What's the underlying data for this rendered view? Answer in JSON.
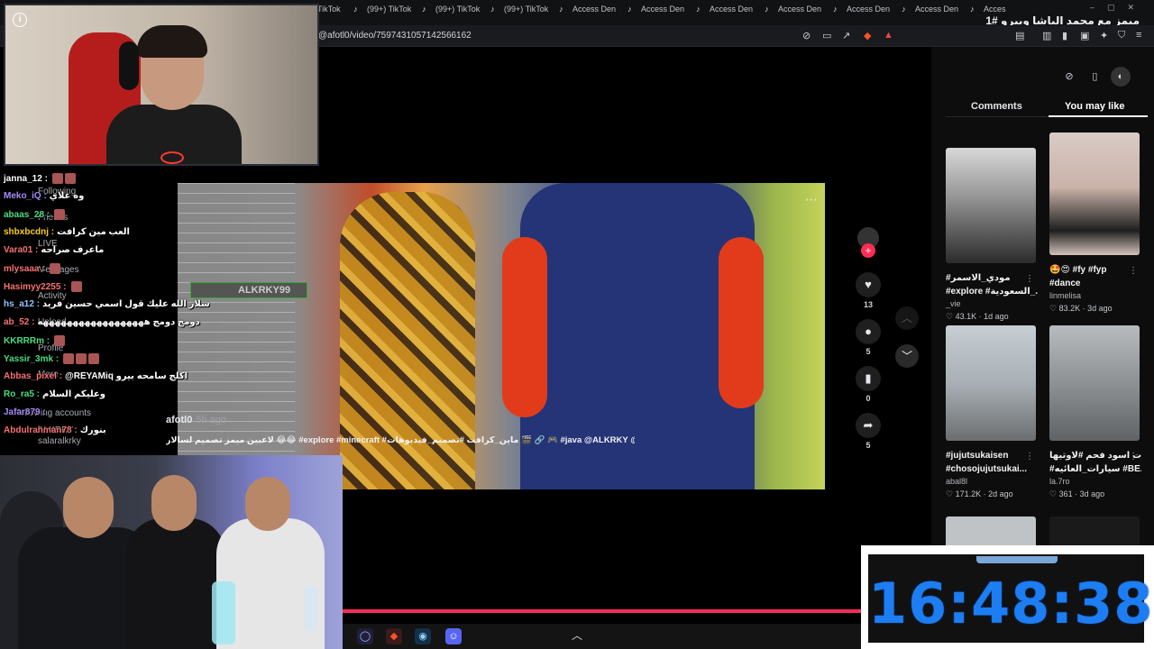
{
  "browser": {
    "tabs": [
      {
        "label": "TikTok",
        "icon": "tiktok-icon"
      },
      {
        "label": "(99+) TikTok",
        "icon": "tiktok-icon"
      },
      {
        "label": "(99+) TikTok",
        "icon": "tiktok-icon"
      },
      {
        "label": "(99+) TikTok",
        "icon": "tiktok-icon"
      },
      {
        "label": "Access Den",
        "icon": "tiktok-icon"
      },
      {
        "label": "Access Den",
        "icon": "tiktok-icon"
      },
      {
        "label": "Access Den",
        "icon": "tiktok-icon"
      },
      {
        "label": "Access Den",
        "icon": "tiktok-icon"
      },
      {
        "label": "Access Den",
        "icon": "tiktok-icon"
      },
      {
        "label": "Access Den",
        "icon": "tiktok-icon"
      },
      {
        "label": "Access Den",
        "icon": "tiktok-icon"
      }
    ],
    "url": "@afotl0/video/7597431057142566162"
  },
  "stream_title": "ميمز مع محمد الباشا وبيرو #1",
  "right_panel": {
    "tabs": {
      "comments": "Comments",
      "you_may_like": "You may like"
    },
    "cards": [
      {
        "caption1": "#مودي_الاسمر",
        "caption2": "#explore #السعودية_...",
        "user": "_vie",
        "likes": "43.1K",
        "ago": "1d ago"
      },
      {
        "caption1": "🤩😍 #fy #fyp",
        "caption2": "#dance",
        "user": "linmelisa",
        "likes": "83.2K",
        "ago": "3d ago"
      },
      {
        "caption1": "#jujutsukaisen",
        "caption2": "#chosojujutsukai...",
        "user": "abal8l",
        "likes": "171.2K",
        "ago": "2d ago"
      },
      {
        "caption1": "اطارات اسود فحم #لاوتيها",
        "caption2": "#سيارات_العائيه #BE...",
        "user": "la.7ro",
        "likes": "361",
        "ago": "3d ago"
      }
    ]
  },
  "video": {
    "author": "afotl0",
    "posted": "5h ago",
    "description": "لاعبين ميمز تصميم لسالار 😂😂 #explore #minecraft #ماين_كرافت #تصميم_فيديوهات 🎬 🔗 🎮 #java @ALKRKY @BERO",
    "gamertag": "ALKRKY99",
    "progress_percent": 64
  },
  "actions": {
    "likes": "13",
    "comments": "5",
    "saves": "0",
    "shares": "5"
  },
  "chat": [
    {
      "user": "janna_12 :",
      "color": "#ffffff",
      "msg": ""
    },
    {
      "user": "Meko_iQ :",
      "color": "#a78bfa",
      "msg": "وه غلاي"
    },
    {
      "user": "abaas_28 :",
      "color": "#4ade80",
      "msg": ""
    },
    {
      "user": "shbxbcdnj :",
      "color": "#facc15",
      "msg": "العب مين كرافت"
    },
    {
      "user": "Vara01 :",
      "color": "#f87171",
      "msg": "ماعرف صراحه"
    },
    {
      "user": "mlysaaa :",
      "color": "#f87171",
      "msg": ""
    },
    {
      "user": "Hasimyy2255 :",
      "color": "#f87171",
      "msg": ""
    },
    {
      "user": "hs_a12 :",
      "color": "#93c5fd",
      "msg": "سلار الله عليك قول اسمي حسين فريد"
    },
    {
      "user": "ab_52 :",
      "color": "#f87171",
      "msg": "دومج دومج ههههههههههههههههههه"
    },
    {
      "user": "KKRRRm :",
      "color": "#4ade80",
      "msg": ""
    },
    {
      "user": "Yassir_3mk :",
      "color": "#4ade80",
      "msg": ""
    },
    {
      "user": "Abbas_pixel :",
      "color": "#f87171",
      "msg": "@REYAMiq اكلج سامحه بيرو"
    },
    {
      "user": "Ro_ra5 :",
      "color": "#4ade80",
      "msg": "وعليكم السلام"
    },
    {
      "user": "Jafar879 :",
      "color": "#a78bfa",
      "msg": ""
    },
    {
      "user": "Abdulrahman78 :",
      "color": "#f87171",
      "msg": "بنورك"
    }
  ],
  "sidebar_ghost": {
    "following": "Following",
    "friends": "Friends",
    "live": "LIVE",
    "messages": "Messages",
    "activity": "Activity",
    "upload": "Upload",
    "profile": "Profile",
    "more": "More",
    "following_accounts": "Following accounts",
    "account_1": "ALKRKY",
    "account_2": "salaralkrky"
  },
  "clock": "16:48:38",
  "colors": {
    "accent": "#fe2c55",
    "clock": "#1d7df2"
  }
}
